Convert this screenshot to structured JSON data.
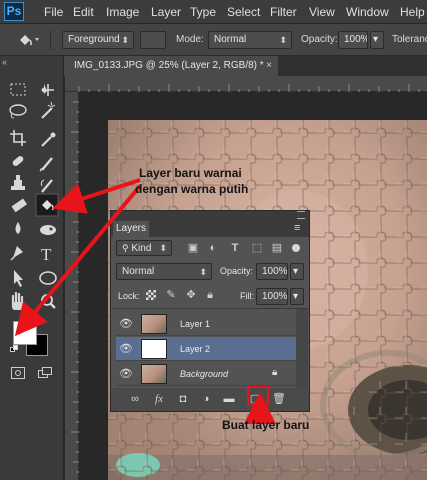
{
  "app": {
    "logo": "Ps"
  },
  "menu": [
    "File",
    "Edit",
    "Image",
    "Layer",
    "Type",
    "Select",
    "Filter",
    "View",
    "Window",
    "Help"
  ],
  "options_bar": {
    "tool_icon": "paint-bucket-icon",
    "source": "Foreground",
    "mode_label": "Mode:",
    "mode_value": "Normal",
    "opacity_label": "Opacity:",
    "opacity_value": "100%",
    "tolerance_label": "Tolerance"
  },
  "document": {
    "tab_title": "IMG_0133.JPG @ 25% (Layer 2, RGB/8) *",
    "close_glyph": "×"
  },
  "panel_collapse_glyph": "«",
  "colors": {
    "foreground": "#ffffff",
    "background": "#000000",
    "annotation_arrow": "#e8141a",
    "selected_layer": "#5a6e92"
  },
  "layers_panel": {
    "tab_label": "Layers",
    "collapse_glyph": "»",
    "menu_glyph": "≡",
    "filter_kind": "Kind",
    "blend_mode": "Normal",
    "opacity_label": "Opacity:",
    "opacity_value": "100%",
    "lock_label": "Lock:",
    "fill_label": "Fill:",
    "fill_value": "100%",
    "layers": [
      {
        "name": "Layer 1",
        "visible": true,
        "selected": false,
        "thumb": "photo"
      },
      {
        "name": "Layer 2",
        "visible": true,
        "selected": true,
        "thumb": "white"
      },
      {
        "name": "Background",
        "visible": true,
        "selected": false,
        "thumb": "photo",
        "locked": true
      }
    ],
    "footer_icons": [
      "link-icon",
      "fx-icon",
      "mask-icon",
      "adjustment-icon",
      "group-folder-icon",
      "new-layer-icon",
      "trash-icon"
    ]
  },
  "annotations": {
    "top_line1": "Layer baru warnai",
    "top_line2": "dengan warna putih",
    "bottom": "Buat layer baru"
  }
}
